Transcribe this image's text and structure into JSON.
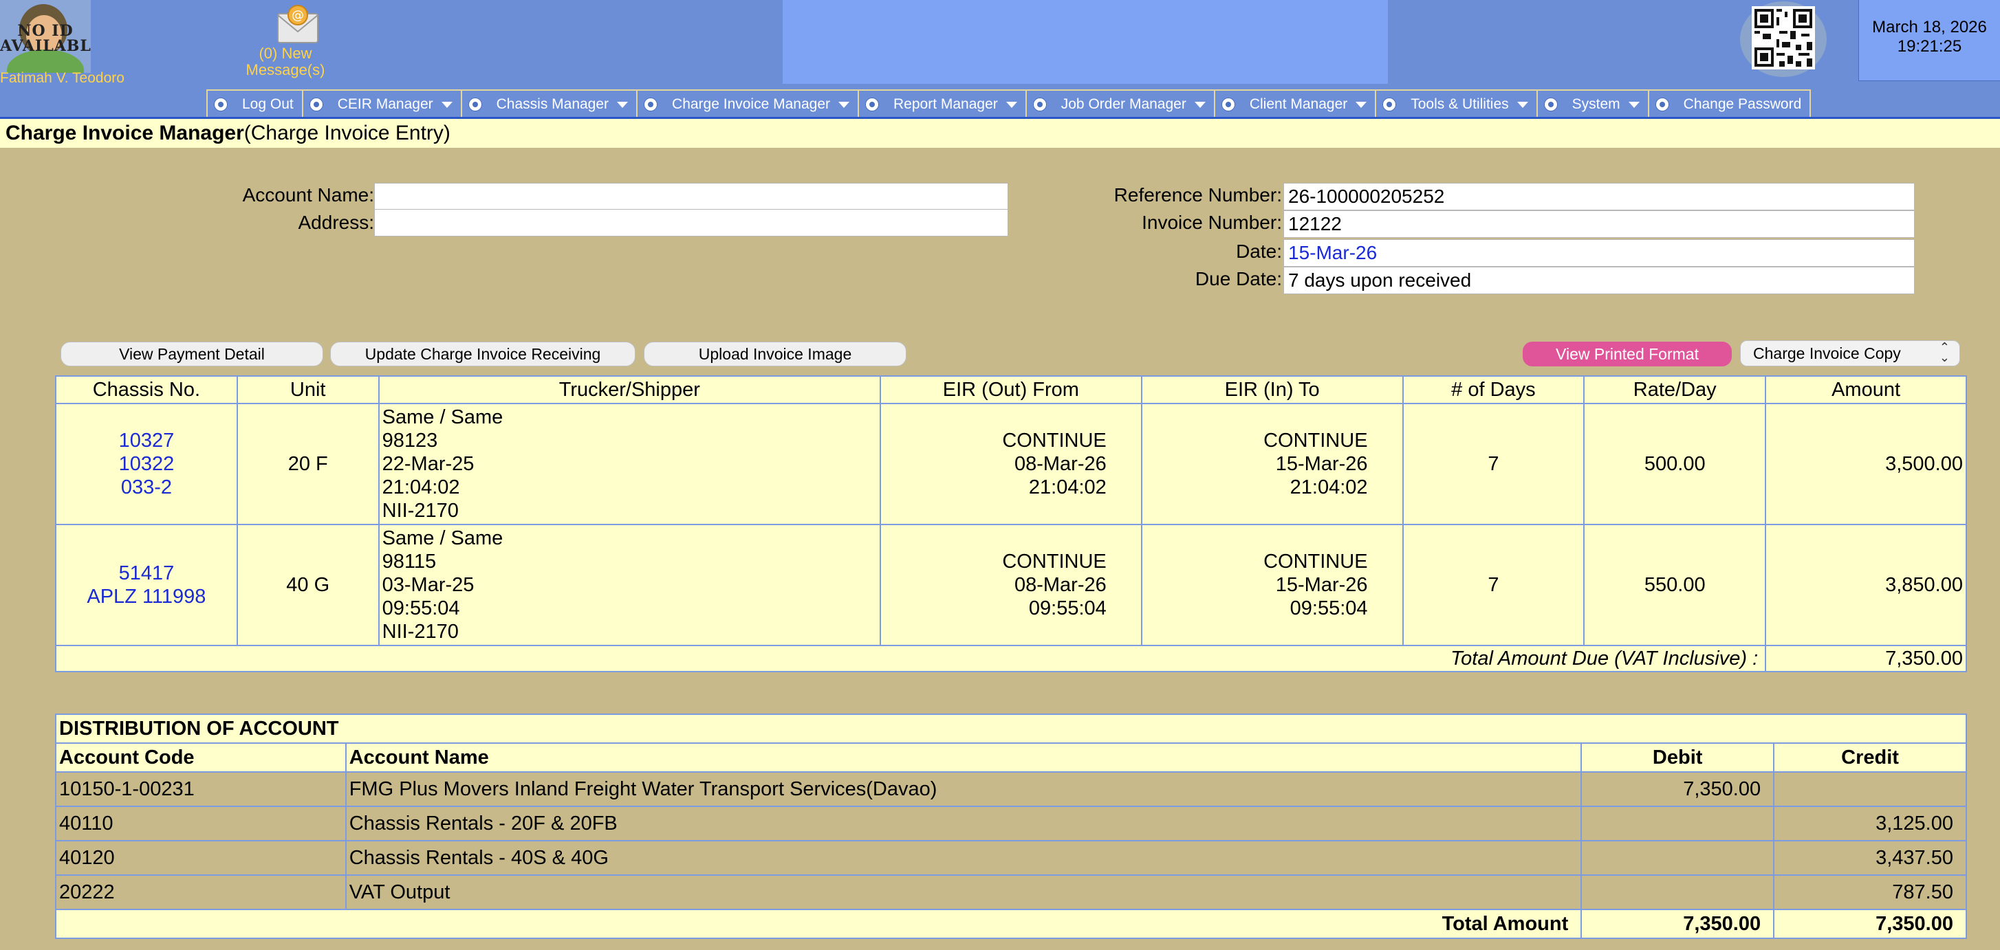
{
  "header": {
    "avatar_text": "NO ID AVAILABLE",
    "user_name": "Fatimah V. Teodoro",
    "messages_label": "(0) New Message(s)",
    "date": "March 18, 2026",
    "time": "19:21:25"
  },
  "menu": [
    {
      "label": "Log Out",
      "dropdown": false
    },
    {
      "label": "CEIR Manager",
      "dropdown": true
    },
    {
      "label": "Chassis Manager",
      "dropdown": true
    },
    {
      "label": "Charge Invoice Manager",
      "dropdown": true
    },
    {
      "label": "Report Manager",
      "dropdown": true
    },
    {
      "label": "Job Order Manager",
      "dropdown": true
    },
    {
      "label": "Client Manager",
      "dropdown": true
    },
    {
      "label": "Tools & Utilities",
      "dropdown": true
    },
    {
      "label": "System",
      "dropdown": true
    },
    {
      "label": "Change Password",
      "dropdown": false
    }
  ],
  "page": {
    "title": "Charge Invoice Manager",
    "subtitle": "(Charge Invoice Entry)"
  },
  "form": {
    "account_name_label": "Account Name:",
    "account_name": "",
    "address_label": "Address:",
    "address": "",
    "reference_label": "Reference Number:",
    "reference": "26-100000205252",
    "invoice_label": "Invoice Number:",
    "invoice": "12122",
    "date_label": "Date:",
    "date": "15-Mar-26",
    "due_label": "Due Date:",
    "due": "7 days upon received"
  },
  "actions": {
    "view_payment": "View Payment Detail",
    "update_receiving": "Update Charge Invoice Receiving",
    "upload_image": "Upload Invoice Image",
    "view_printed": "View Printed Format",
    "copy_select": "Charge Invoice Copy"
  },
  "charges": {
    "columns": [
      "Chassis No.",
      "Unit",
      "Trucker/Shipper",
      "EIR (Out) From",
      "EIR (In) To",
      "# of Days",
      "Rate/Day",
      "Amount"
    ],
    "rows": [
      {
        "chassis": [
          "10327",
          "10322",
          "033-2"
        ],
        "unit": "20 F",
        "trucker": [
          "Same / Same",
          "98123",
          "22-Mar-25",
          "21:04:02",
          "NII-2170"
        ],
        "eir_out": [
          "CONTINUE",
          "08-Mar-26",
          "21:04:02"
        ],
        "eir_in": [
          "CONTINUE",
          "15-Mar-26",
          "21:04:02"
        ],
        "days": "7",
        "rate": "500.00",
        "amount": "3,500.00"
      },
      {
        "chassis": [
          "51417",
          "APLZ 111998"
        ],
        "unit": "40 G",
        "trucker": [
          "Same / Same",
          "98115",
          "03-Mar-25",
          "09:55:04",
          "NII-2170"
        ],
        "eir_out": [
          "CONTINUE",
          "08-Mar-26",
          "09:55:04"
        ],
        "eir_in": [
          "CONTINUE",
          "15-Mar-26",
          "09:55:04"
        ],
        "days": "7",
        "rate": "550.00",
        "amount": "3,850.00"
      }
    ],
    "total_label": "Total Amount Due (VAT Inclusive) :",
    "total": "7,350.00"
  },
  "distribution": {
    "caption": "DISTRIBUTION OF ACCOUNT",
    "columns": [
      "Account Code",
      "Account Name",
      "Debit",
      "Credit"
    ],
    "rows": [
      {
        "code": "10150-1-00231",
        "name": "FMG Plus Movers Inland Freight Water Transport Services(Davao)",
        "debit": "7,350.00",
        "credit": ""
      },
      {
        "code": "40110",
        "name": "Chassis Rentals - 20F & 20FB",
        "debit": "",
        "credit": "3,125.00"
      },
      {
        "code": "40120",
        "name": "Chassis Rentals - 40S & 40G",
        "debit": "",
        "credit": "3,437.50"
      },
      {
        "code": "20222",
        "name": "VAT Output",
        "debit": "",
        "credit": "787.50"
      }
    ],
    "total_label": "Total Amount",
    "total_debit": "7,350.00",
    "total_credit": "7,350.00"
  }
}
